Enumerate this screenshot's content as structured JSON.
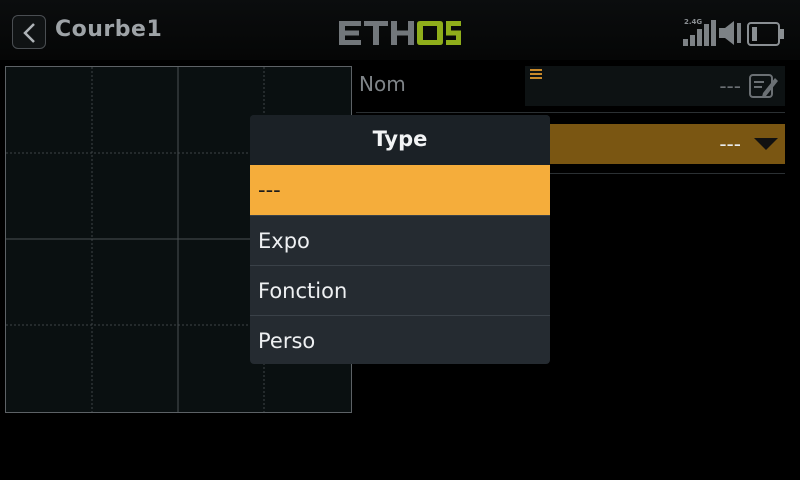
{
  "header": {
    "title": "Courbe1",
    "logo_text": "ETHOS",
    "radio_label": "2.4G",
    "accent": "#8fae1b",
    "icons": [
      "back-arrow-icon",
      "signal-icon",
      "speaker-icon",
      "battery-icon"
    ]
  },
  "form": {
    "name_label": "Nom",
    "name_value": "---",
    "type_value": "---",
    "type_field_color": "#7a5612"
  },
  "modal": {
    "title": "Type",
    "options": [
      "---",
      "Expo",
      "Fonction",
      "Perso"
    ],
    "selected_index": 0,
    "selected_color": "#f5ad3b"
  }
}
